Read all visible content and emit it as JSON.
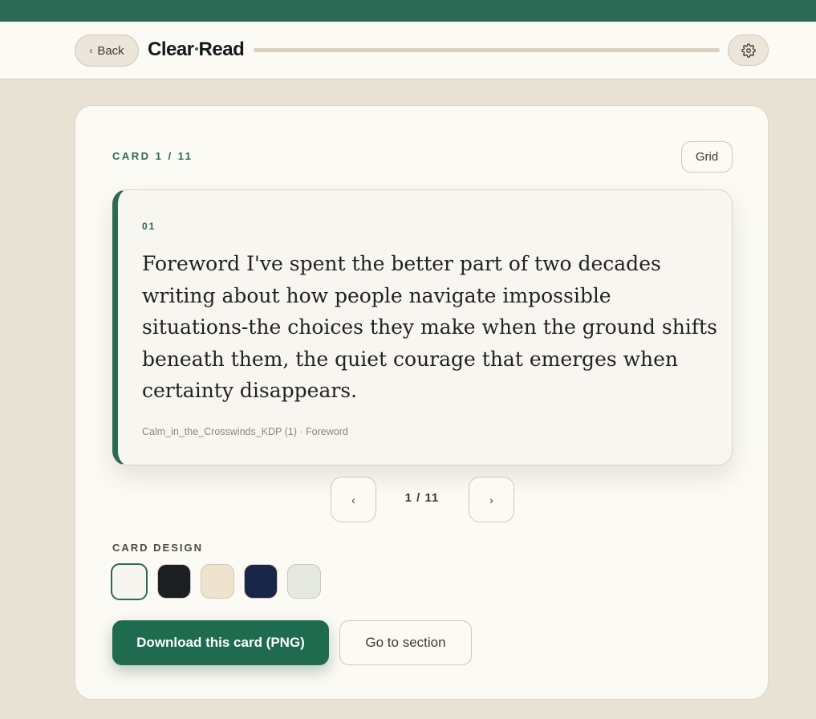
{
  "header": {
    "back_label": "Back",
    "brand_left": "Clear",
    "brand_right": "Read",
    "progress_fraction": 0.0
  },
  "panel": {
    "card_counter": "CARD 1 / 11",
    "grid_label": "Grid",
    "card": {
      "number": "01",
      "body": "Foreword I've spent the better part of two decades writing about how people navigate impossible situations-the choices they make when the ground shifts beneath them, the quiet courage that emerges when certainty disappears.",
      "source": "Calm_in_the_Crosswinds_KDP (1) · Foreword"
    },
    "pager": {
      "prev_glyph": "‹",
      "indicator": "1 / 11",
      "next_glyph": "›"
    },
    "design": {
      "label": "CARD DESIGN",
      "swatches": [
        {
          "name": "light",
          "color": "#f7f5ef",
          "selected": true
        },
        {
          "name": "black",
          "color": "#1b1f22",
          "selected": false
        },
        {
          "name": "cream",
          "color": "#efe3cf",
          "selected": false
        },
        {
          "name": "navy",
          "color": "#1a2648",
          "selected": false
        },
        {
          "name": "sage",
          "color": "#e5e9e2",
          "selected": false
        }
      ]
    },
    "download_label": "Download this card (PNG)",
    "goto_label": "Go to section"
  },
  "colors": {
    "accent": "#2d6a55",
    "download_button": "#1e6b4f",
    "background": "#e8e2d5"
  },
  "icons": {
    "back": "chevron-left-icon",
    "settings": "gear-icon"
  }
}
